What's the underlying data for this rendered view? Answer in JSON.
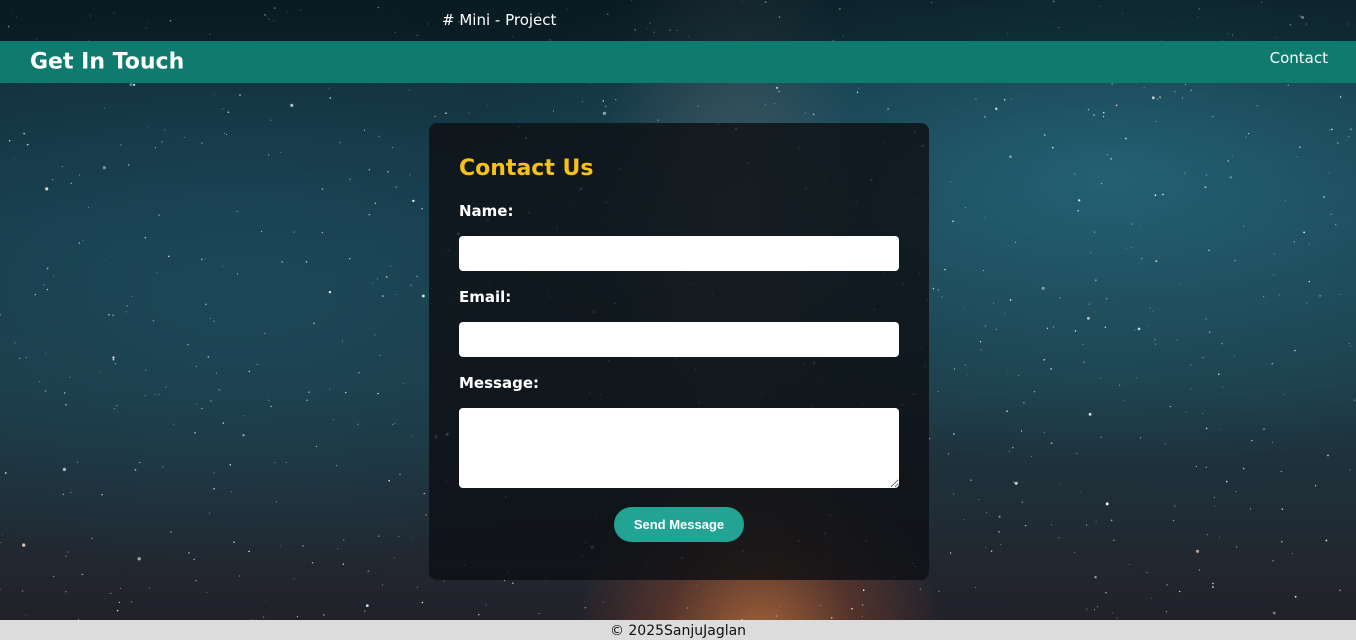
{
  "page": {
    "document_title": "# Mini - Project"
  },
  "navbar": {
    "brand": "Get In Touch",
    "links": [
      "Contact"
    ]
  },
  "contact_form": {
    "title": "Contact Us",
    "name_label": "Name:",
    "name_value": "",
    "email_label": "Email:",
    "email_value": "",
    "message_label": "Message:",
    "message_value": "",
    "submit_label": "Send Message"
  },
  "footer": {
    "text": "© 2025SanjuJaglan"
  },
  "colors": {
    "navbar_bg": "#0f7a6e",
    "title_accent": "#f6c21a",
    "button_bg": "#23a394",
    "card_bg": "#0e1014",
    "footer_bg": "#dcdcdc"
  }
}
